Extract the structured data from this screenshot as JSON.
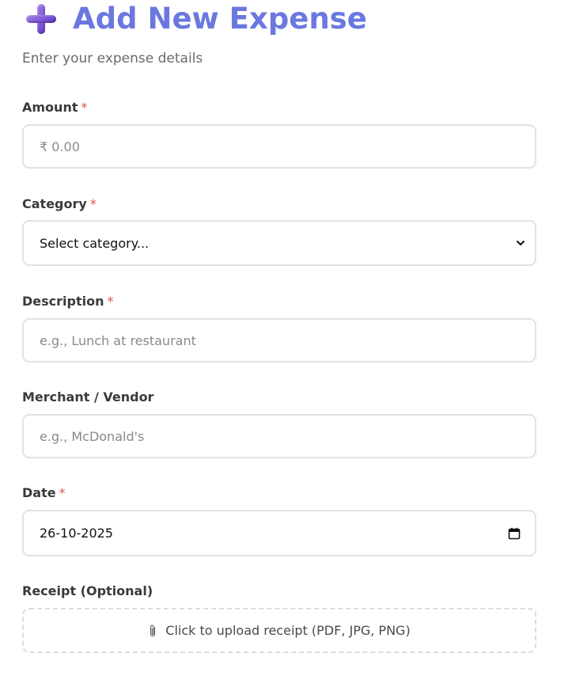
{
  "header": {
    "title": "Add New Expense",
    "subtitle": "Enter your expense details",
    "icon": "plus-icon"
  },
  "form": {
    "required_marker": "*",
    "amount": {
      "label": "Amount",
      "required": true,
      "placeholder": "₹ 0.00",
      "value": ""
    },
    "category": {
      "label": "Category",
      "required": true,
      "selected": "Select category...",
      "icon": "chevron-down-icon"
    },
    "description": {
      "label": "Description",
      "required": true,
      "placeholder": "e.g., Lunch at restaurant",
      "value": ""
    },
    "merchant": {
      "label": "Merchant / Vendor",
      "required": false,
      "placeholder": "e.g., McDonald's",
      "value": ""
    },
    "date": {
      "label": "Date",
      "required": true,
      "value": "26-10-2025",
      "icon": "calendar-icon"
    },
    "receipt": {
      "label": "Receipt (Optional)",
      "upload_text": "Click to upload receipt (PDF, JPG, PNG)",
      "icon": "paperclip-icon"
    }
  },
  "colors": {
    "title": "#6b78e0",
    "required": "#e0524f",
    "border": "#e2e2e2"
  }
}
